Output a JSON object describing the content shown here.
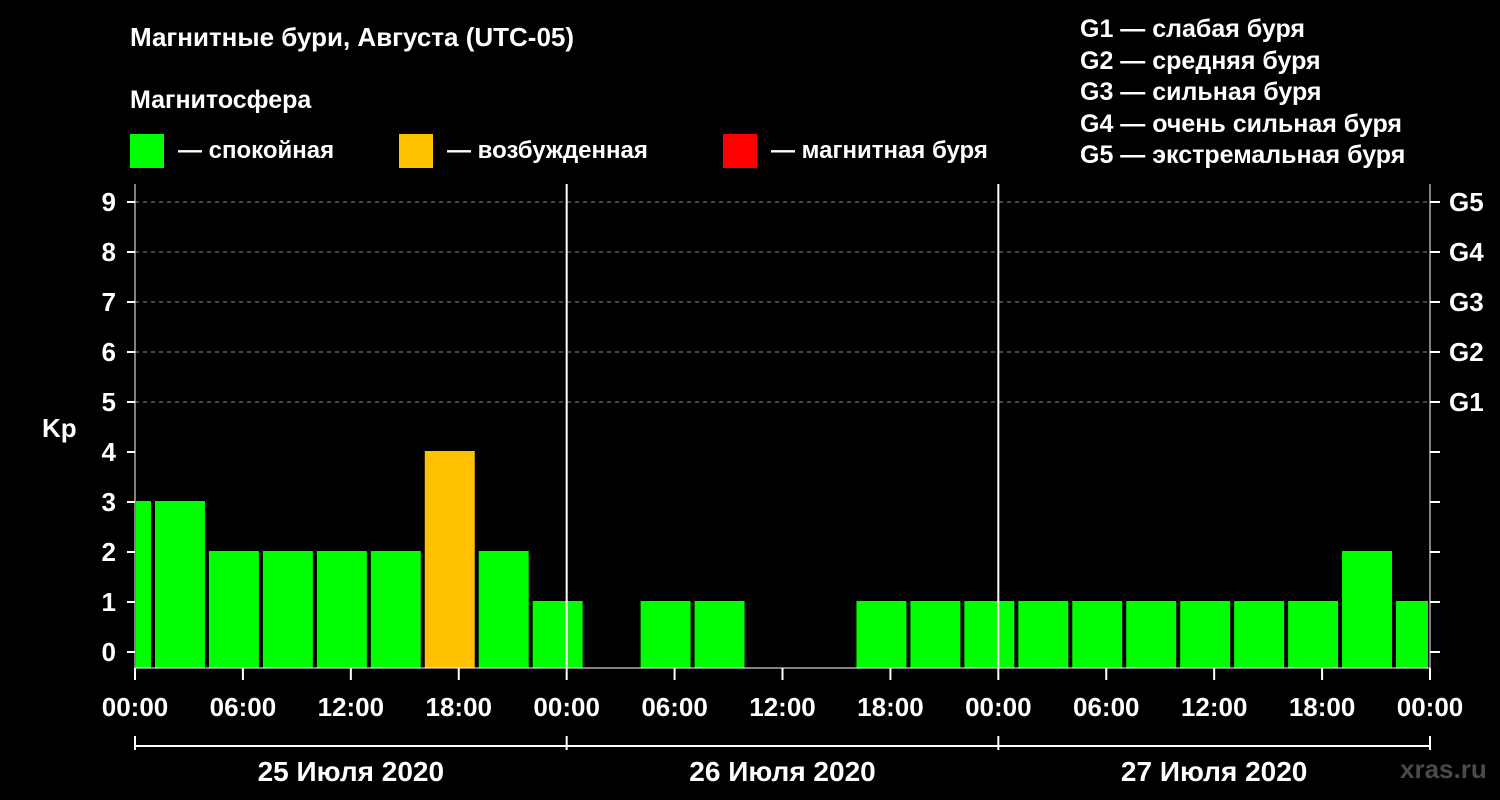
{
  "chart_data": {
    "type": "bar",
    "title": "Магнитные бури, Августа (UTC-05)",
    "subtitle": "Магнитосфера",
    "ylabel": "Kp",
    "ylim": [
      0,
      9
    ],
    "y_ticks": [
      0,
      1,
      2,
      3,
      4,
      5,
      6,
      7,
      8,
      9
    ],
    "right_ticks": [
      {
        "kp": 5,
        "label": "G1"
      },
      {
        "kp": 6,
        "label": "G2"
      },
      {
        "kp": 7,
        "label": "G3"
      },
      {
        "kp": 8,
        "label": "G4"
      },
      {
        "kp": 9,
        "label": "G5"
      }
    ],
    "x_tick_labels": [
      "00:00",
      "06:00",
      "12:00",
      "18:00",
      "00:00",
      "06:00",
      "12:00",
      "18:00",
      "00:00",
      "06:00",
      "12:00",
      "18:00",
      "00:00"
    ],
    "days": [
      "25 Июля 2020",
      "26 Июля 2020",
      "27 Июля 2020"
    ],
    "status_legend": [
      {
        "label": "— спокойная",
        "color": "#00ff00"
      },
      {
        "label": "— возбужденная",
        "color": "#ffc000"
      },
      {
        "label": "— магнитная буря",
        "color": "#ff0000"
      }
    ],
    "storm_legend": [
      "G1 — слабая буря",
      "G2 — средняя буря",
      "G3 — сильная буря",
      "G4 — очень сильная буря",
      "G5 — экстремальная буря"
    ],
    "colors": {
      "quiet": "#00ff00",
      "active": "#ffc000",
      "storm": "#ff0000"
    },
    "grid": true,
    "bars": [
      {
        "start_hour": 0,
        "end_hour": 1,
        "kp": 3,
        "status": "quiet"
      },
      {
        "start_hour": 1,
        "end_hour": 4,
        "kp": 3,
        "status": "quiet"
      },
      {
        "start_hour": 4,
        "end_hour": 7,
        "kp": 2,
        "status": "quiet"
      },
      {
        "start_hour": 7,
        "end_hour": 10,
        "kp": 2,
        "status": "quiet"
      },
      {
        "start_hour": 10,
        "end_hour": 13,
        "kp": 2,
        "status": "quiet"
      },
      {
        "start_hour": 13,
        "end_hour": 16,
        "kp": 2,
        "status": "quiet"
      },
      {
        "start_hour": 16,
        "end_hour": 19,
        "kp": 4,
        "status": "active"
      },
      {
        "start_hour": 19,
        "end_hour": 22,
        "kp": 2,
        "status": "quiet"
      },
      {
        "start_hour": 22,
        "end_hour": 25,
        "kp": 1,
        "status": "quiet"
      },
      {
        "start_hour": 25,
        "end_hour": 28,
        "kp": 0,
        "status": "quiet"
      },
      {
        "start_hour": 28,
        "end_hour": 31,
        "kp": 1,
        "status": "quiet"
      },
      {
        "start_hour": 31,
        "end_hour": 34,
        "kp": 1,
        "status": "quiet"
      },
      {
        "start_hour": 34,
        "end_hour": 37,
        "kp": 0,
        "status": "quiet"
      },
      {
        "start_hour": 37,
        "end_hour": 40,
        "kp": 0,
        "status": "quiet"
      },
      {
        "start_hour": 40,
        "end_hour": 43,
        "kp": 1,
        "status": "quiet"
      },
      {
        "start_hour": 43,
        "end_hour": 46,
        "kp": 1,
        "status": "quiet"
      },
      {
        "start_hour": 46,
        "end_hour": 49,
        "kp": 1,
        "status": "quiet"
      },
      {
        "start_hour": 49,
        "end_hour": 52,
        "kp": 1,
        "status": "quiet"
      },
      {
        "start_hour": 52,
        "end_hour": 55,
        "kp": 1,
        "status": "quiet"
      },
      {
        "start_hour": 55,
        "end_hour": 58,
        "kp": 1,
        "status": "quiet"
      },
      {
        "start_hour": 58,
        "end_hour": 61,
        "kp": 1,
        "status": "quiet"
      },
      {
        "start_hour": 61,
        "end_hour": 64,
        "kp": 1,
        "status": "quiet"
      },
      {
        "start_hour": 64,
        "end_hour": 67,
        "kp": 1,
        "status": "quiet"
      },
      {
        "start_hour": 67,
        "end_hour": 70,
        "kp": 2,
        "status": "quiet"
      },
      {
        "start_hour": 70,
        "end_hour": 72,
        "kp": 1,
        "status": "quiet"
      }
    ]
  },
  "watermark": "xras.ru"
}
